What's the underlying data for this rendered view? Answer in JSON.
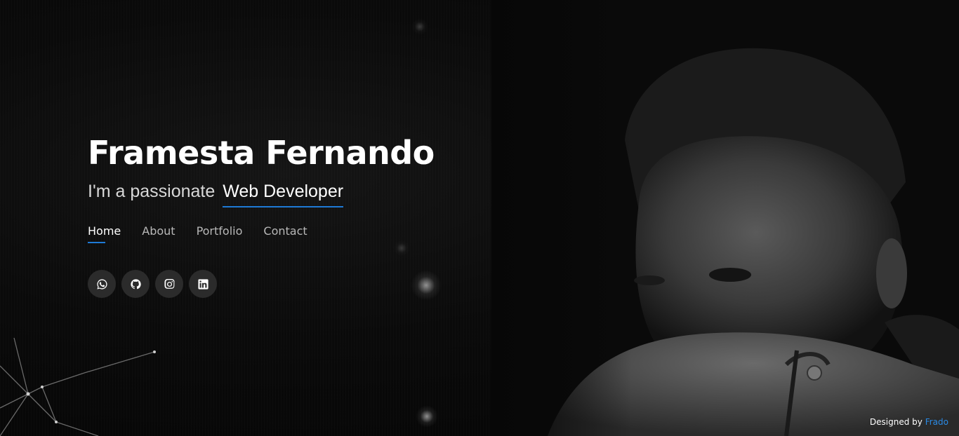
{
  "hero": {
    "name": "Framesta Fernando",
    "tagline_prefix": "I'm a passionate",
    "tagline_role": "Web Developer"
  },
  "nav": {
    "items": [
      {
        "label": "Home",
        "active": true
      },
      {
        "label": "About",
        "active": false
      },
      {
        "label": "Portfolio",
        "active": false
      },
      {
        "label": "Contact",
        "active": false
      }
    ]
  },
  "socials": [
    {
      "icon": "whatsapp-icon"
    },
    {
      "icon": "github-icon"
    },
    {
      "icon": "instagram-icon"
    },
    {
      "icon": "linkedin-icon"
    }
  ],
  "footer": {
    "credit_prefix": "Designed by",
    "credit_author": "Frado"
  },
  "colors": {
    "accent": "#1e7ad6",
    "link": "#2a8be6",
    "background": "#050505",
    "social_bg": "#2b2b2b"
  }
}
